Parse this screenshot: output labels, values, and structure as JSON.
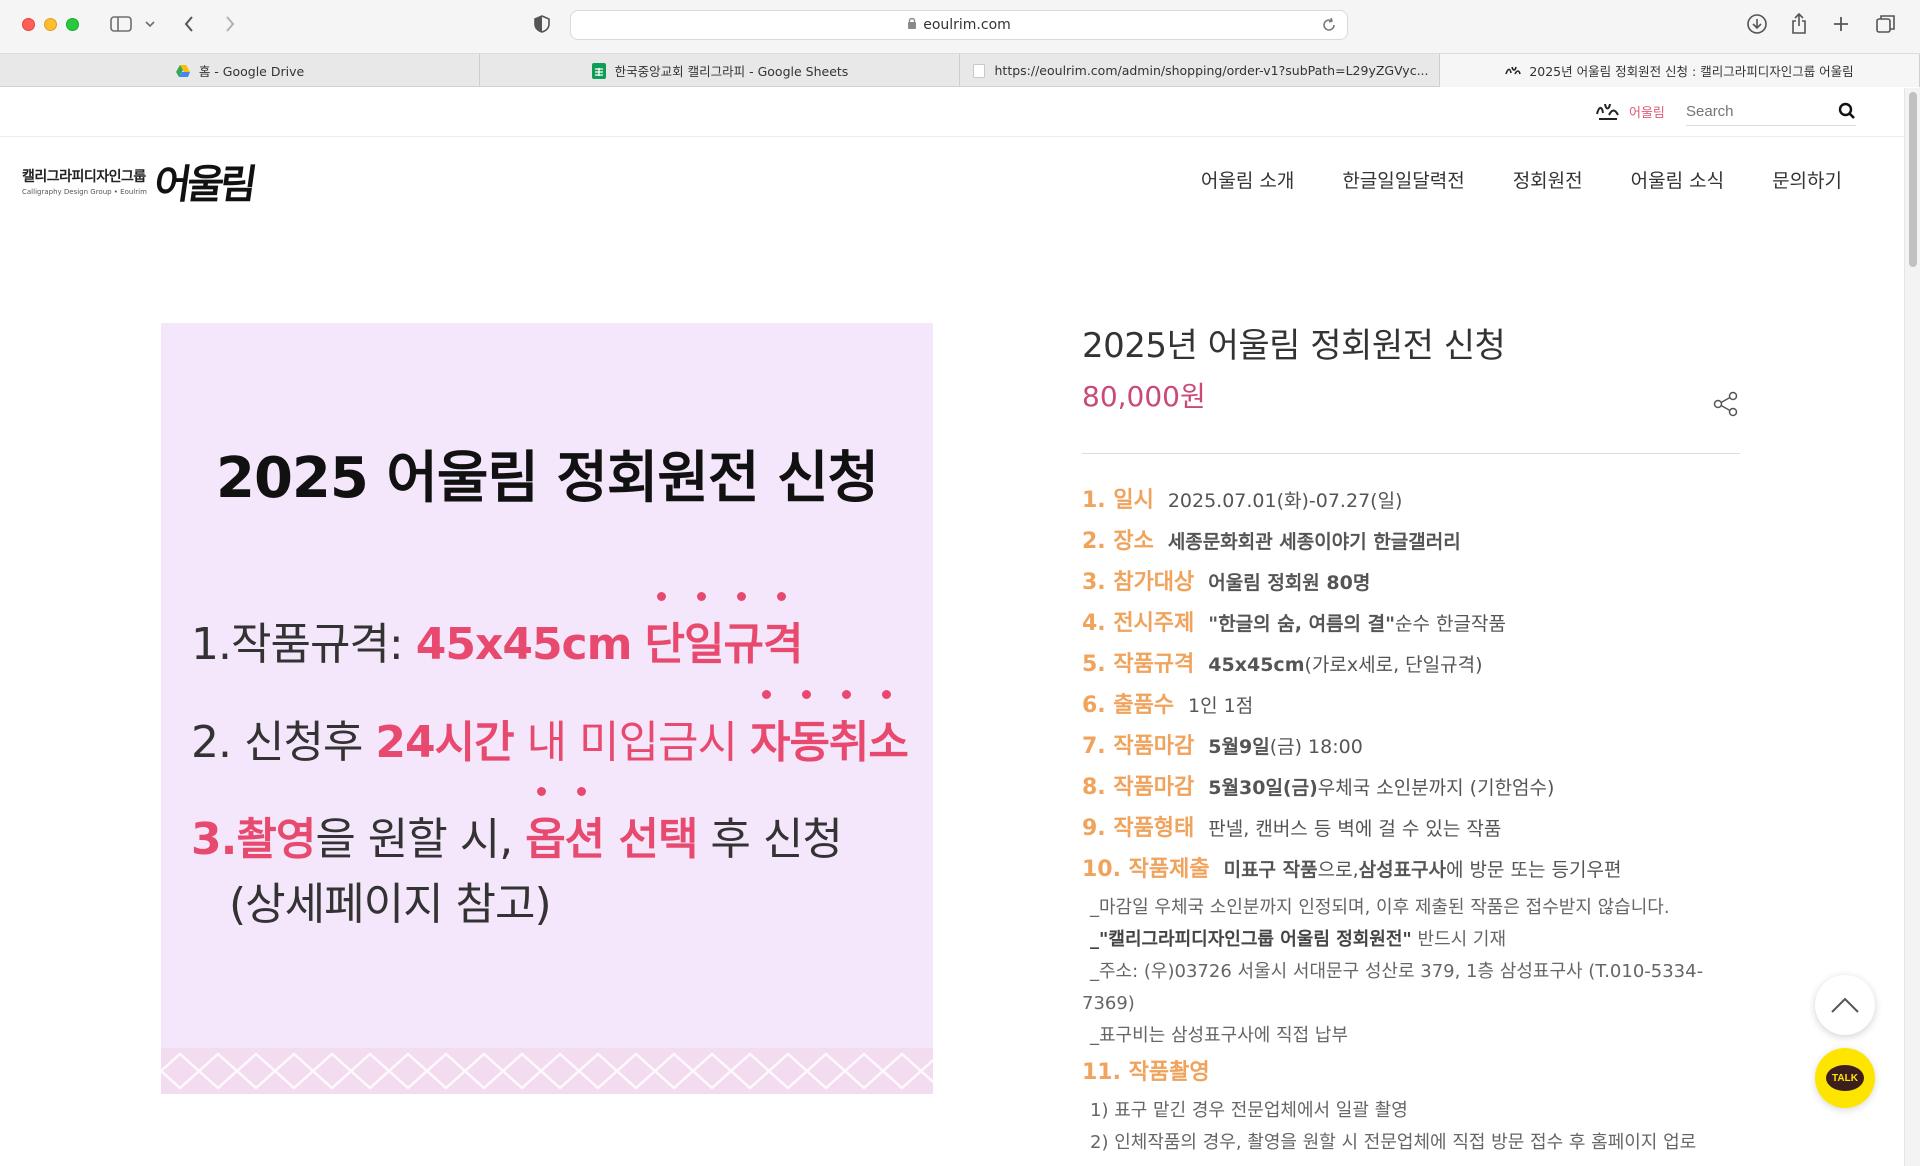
{
  "browser": {
    "url": "eoulrim.com",
    "tabs": [
      {
        "label": "홈 - Google Drive",
        "favicon": "google-drive-icon"
      },
      {
        "label": "한국중앙교회 캘리그라피 - Google Sheets",
        "favicon": "google-sheets-icon"
      },
      {
        "label": "https://eoulrim.com/admin/shopping/order-v1?subPath=L29yZGVyc...",
        "favicon": "blank-page-icon"
      },
      {
        "label": "2025년 어울림 정회원전 신청 : 캘리그라피디자인그룹 어울림",
        "favicon": "eoulrim-icon",
        "active": true
      }
    ]
  },
  "site": {
    "top_brand": "어울림",
    "search_placeholder": "Search",
    "logo": {
      "main": "캘리그라피디자인그룹",
      "sub": "Calligraphy Design Group • Eoulrim",
      "mark": "어울림"
    },
    "nav": [
      "어울림 소개",
      "한글일일달력전",
      "정회원전",
      "어울림 소식",
      "문의하기"
    ]
  },
  "banner": {
    "title": "2025 어울림 정회원전 신청",
    "line1": {
      "prefix": "1.작품규격: ",
      "pink1": "45x45cm",
      "pink2": "단일규격"
    },
    "line2": {
      "prefix": "2. 신청후 ",
      "pink1": "24시간",
      "mid": " 내 미입금시 ",
      "pink2": "자동취소"
    },
    "line3": {
      "num": "3.",
      "pink1": "촬영",
      "mid": "을 원할 시, ",
      "pink2": "옵션 선택",
      "suffix": " 후 신청"
    },
    "line4": "(상세페이지 참고)"
  },
  "product": {
    "title": "2025년 어울림 정회원전 신청",
    "price": "80,000원",
    "rows": [
      {
        "label": "1. 일시",
        "value": "2025.07.01(화)-07.27(일)"
      },
      {
        "label": "2. 장소",
        "value": "세종문화회관 세종이야기 한글갤러리"
      },
      {
        "label": "3. 참가대상",
        "value": "어울림 정회원 80명"
      },
      {
        "label": "4. 전시주제",
        "bold": "\"한글의 숨, 여름의 결\"",
        "value": " 순수 한글작품"
      },
      {
        "label": "5. 작품규격",
        "bold": "45x45cm",
        "value": " (가로x세로, 단일규격)"
      },
      {
        "label": "6. 출품수",
        "value": "1인 1점"
      },
      {
        "label": "7. 작품마감",
        "bold": "5월9일",
        "value": "(금) 18:00"
      },
      {
        "label": "8. 작품마감",
        "bold": "5월30일(금)",
        "value": " 우체국 소인분까지 (기한엄수)"
      },
      {
        "label": "9. 작품형태",
        "value": "판넬, 캔버스 등 벽에 걸 수 있는 작품"
      }
    ],
    "row10": {
      "label": "10. 작품제출",
      "bold1": "미표구 작품",
      "mid": "으로, ",
      "bold2": "삼성표구사",
      "suffix": "에 방문 또는 등기우편"
    },
    "notes": [
      "_마감일 우체국 소인분까지 인정되며, 이후 제출된 작품은 접수받지 않습니다.",
      "_주소: (우)03726 서울시 서대문구 성산로 379, 1층 삼성표구사 (T.010-5334-7369)",
      "_표구비는 삼성표구사에 직접 납부"
    ],
    "note_name": {
      "bold": "_\"캘리그라피디자인그룹 어울림 정회원전\"",
      "suffix": " 반드시 기재"
    },
    "row11": {
      "label": "11. 작품촬영"
    },
    "row11_items": [
      "1) 표구 맡긴 경우 전문업체에서 일괄 촬영",
      "2) 인체작품의 경우, 촬영을 원할 시 전문업체에 직접 방문 접수 후 홈페이지 업로"
    ]
  },
  "floating": {
    "talk_label": "TALK"
  },
  "colors": {
    "accent_orange": "#f0a35c",
    "price_pink": "#c9497b",
    "banner_bg": "#f5e7fb",
    "banner_pink": "#e84a6f",
    "kakao_yellow": "#fee500"
  }
}
